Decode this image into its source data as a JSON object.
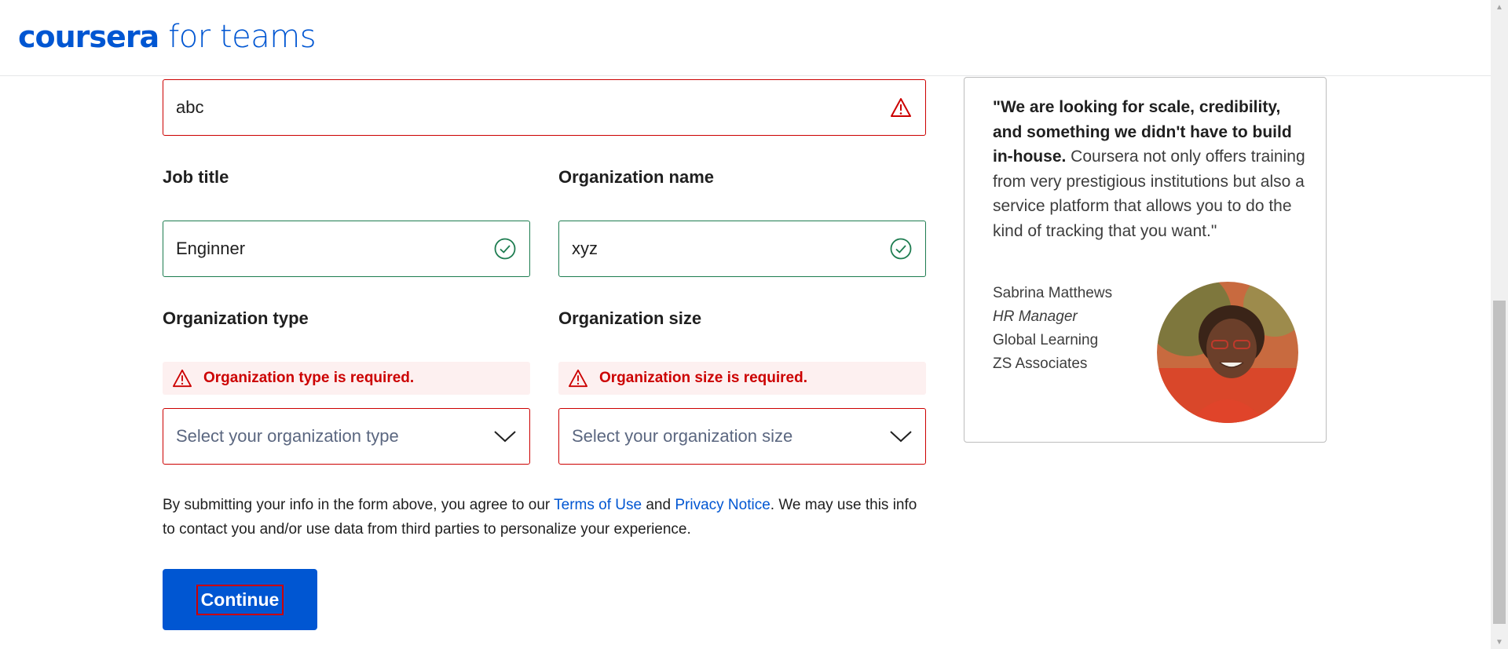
{
  "brand": {
    "logo_main": "coursera",
    "logo_sub": "for teams"
  },
  "form": {
    "top_field": {
      "value": "abc",
      "state": "error",
      "icon": "warning-icon"
    },
    "job_title": {
      "label": "Job title",
      "value": "Enginner",
      "state": "valid",
      "icon": "check-circle-icon"
    },
    "org_name": {
      "label": "Organization name",
      "value": "xyz",
      "state": "valid",
      "icon": "check-circle-icon"
    },
    "org_type": {
      "label": "Organization type",
      "error": "Organization type is required.",
      "placeholder": "Select your organization type"
    },
    "org_size": {
      "label": "Organization size",
      "error": "Organization size is required.",
      "placeholder": "Select your organization size"
    },
    "consent": {
      "before_terms": "By submitting your info in the form above, you agree to our ",
      "terms_link": "Terms of Use",
      "and": " and ",
      "privacy_link": "Privacy Notice",
      "after": ". We may use this info to contact you and/or use data from third parties to personalize your experience."
    },
    "continue_label": "Continue"
  },
  "testimonial": {
    "quote_bold": "\"We are looking for scale, credibility, and something we didn't have to build in-house.",
    "quote_rest": " Coursera not only offers training from very prestigious institutions but also a service platform that allows you to do the kind of tracking that you want.\"",
    "name": "Sabrina Matthews",
    "role": "HR Manager",
    "department": "Global Learning",
    "company": "ZS Associates"
  },
  "colors": {
    "brand": "#0056d2",
    "error": "#cc0000",
    "success": "#1d7c50",
    "error_bg": "#fdf0f0"
  }
}
